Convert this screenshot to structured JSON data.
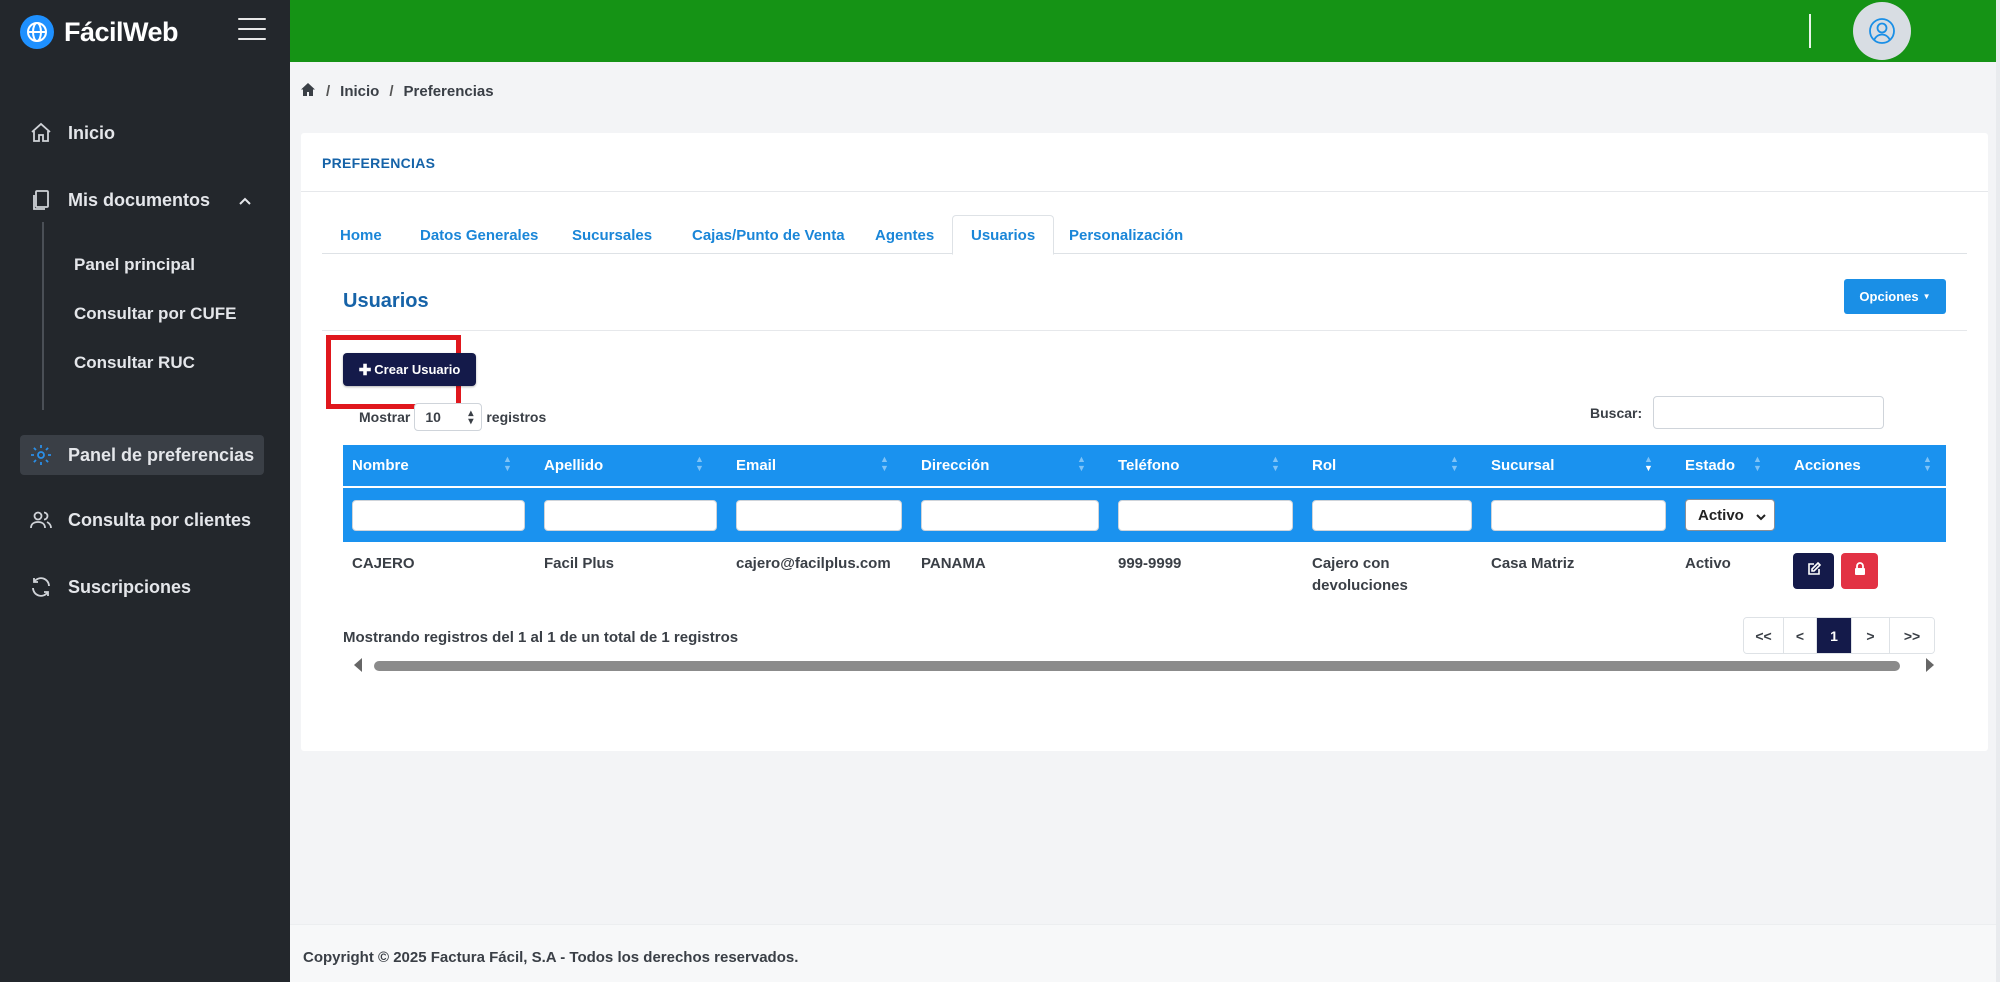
{
  "brand": {
    "name": "FácilWeb"
  },
  "sidebar": {
    "items": [
      {
        "label": "Inicio",
        "icon": "home-icon"
      },
      {
        "label": "Mis documentos",
        "icon": "documents-icon"
      },
      {
        "label": "Panel de preferencias",
        "icon": "gear-icon"
      },
      {
        "label": "Consulta por clientes",
        "icon": "users-icon"
      },
      {
        "label": "Suscripciones",
        "icon": "refresh-icon"
      }
    ],
    "subitems": [
      "Panel principal",
      "Consultar por CUFE",
      "Consultar RUC"
    ]
  },
  "breadcrumb": {
    "home": "Inicio",
    "current": "Preferencias"
  },
  "card": {
    "title": "PREFERENCIAS"
  },
  "tabs": [
    "Home",
    "Datos Generales",
    "Sucursales",
    "Cajas/Punto de Venta",
    "Agentes",
    "Usuarios",
    "Personalización"
  ],
  "section": {
    "title": "Usuarios",
    "options_label": "Opciones",
    "create_label": "Crear Usuario"
  },
  "table_controls": {
    "show_label": "Mostrar",
    "show_value": "10",
    "records_label": "registros",
    "search_label": "Buscar:"
  },
  "table": {
    "columns": [
      "Nombre",
      "Apellido",
      "Email",
      "Dirección",
      "Teléfono",
      "Rol",
      "Sucursal",
      "Estado",
      "Acciones"
    ],
    "estado_filter": "Activo",
    "rows": [
      {
        "nombre": "CAJERO",
        "apellido": "Facil Plus",
        "email": "cajero@facilplus.com",
        "direccion": "PANAMA",
        "telefono": "999-9999",
        "rol_line1": "Cajero con",
        "rol_line2": "devoluciones",
        "sucursal": "Casa Matriz",
        "estado": "Activo"
      }
    ]
  },
  "pagination": {
    "info": "Mostrando registros del 1 al 1 de un total de 1 registros",
    "first": "<<",
    "prev": "<",
    "page": "1",
    "next": ">",
    "last": ">>"
  },
  "footer": {
    "text": "Copyright © 2025 Factura Fácil, S.A - Todos los derechos reservados."
  },
  "colors": {
    "topbar": "#159315",
    "sidebar": "#23272c",
    "table_header": "#1a92ef",
    "primary_dark": "#141a4a",
    "danger": "#e23244"
  }
}
